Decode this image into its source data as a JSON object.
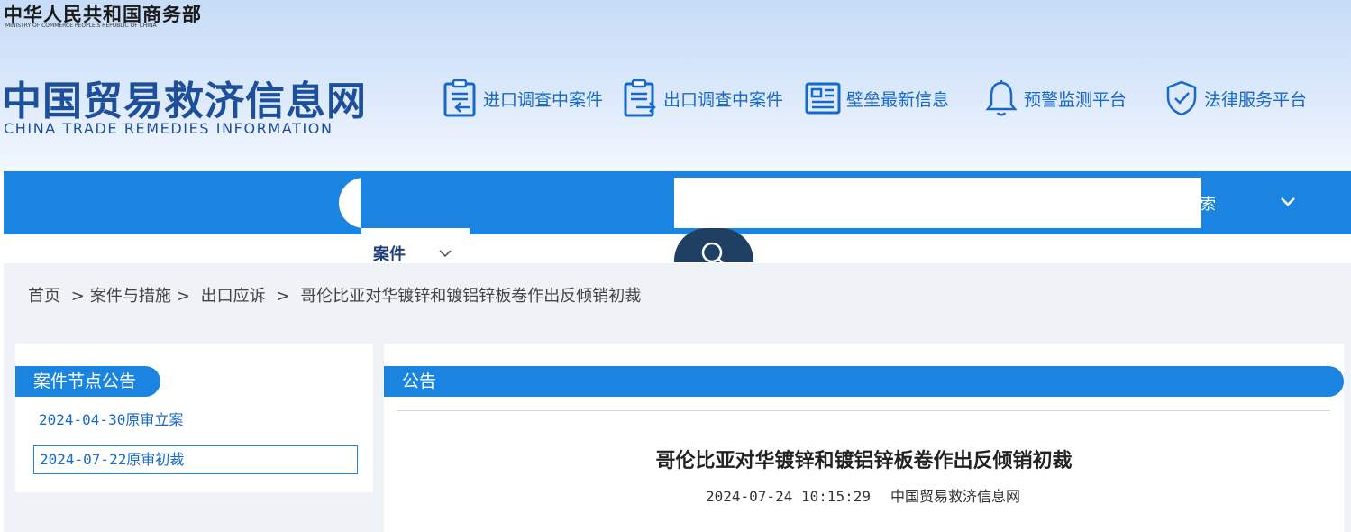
{
  "header": {
    "ministry_cn": "中华人民共和国商务部",
    "ministry_en": "MINISTRY OF COMMERCE PEOPLE'S REPUBLIC OF CHINA",
    "site_cn": "中国贸易救济信息网",
    "site_en": "CHINA TRADE REMEDIES INFORMATION",
    "quick_links": [
      {
        "label": "进口调查中案件",
        "icon": "import-clipboard-icon"
      },
      {
        "label": "出口调查中案件",
        "icon": "export-clipboard-icon"
      },
      {
        "label": "壁垒最新信息",
        "icon": "newspaper-icon"
      },
      {
        "label": "预警监测平台",
        "icon": "bell-icon"
      },
      {
        "label": "法律服务平台",
        "icon": "shield-check-icon"
      }
    ]
  },
  "search": {
    "category": "案件",
    "tail_text": "搜索",
    "input_value": ""
  },
  "breadcrumb": {
    "home": "首页",
    "sep1": ">",
    "level1": "案件与措施",
    "sep2": ">",
    "level2": "出口应诉",
    "sep3": ">",
    "current": "哥伦比亚对华镀锌和镀铝锌板卷作出反倾销初裁"
  },
  "sidebar": {
    "title": "案件节点公告",
    "nodes": [
      {
        "label": "2024-04-30原审立案"
      },
      {
        "label": "2024-07-22原审初裁"
      }
    ]
  },
  "main": {
    "tab": "公告",
    "article_title": "哥伦比亚对华镀锌和镀铝锌板卷作出反倾销初裁",
    "date": "2024-07-24 10:15:29",
    "source": "中国贸易救济信息网"
  },
  "colors": {
    "primary_blue": "#1a84e0",
    "dark_blue": "#1d4f9b",
    "search_button": "#1f3f63"
  }
}
